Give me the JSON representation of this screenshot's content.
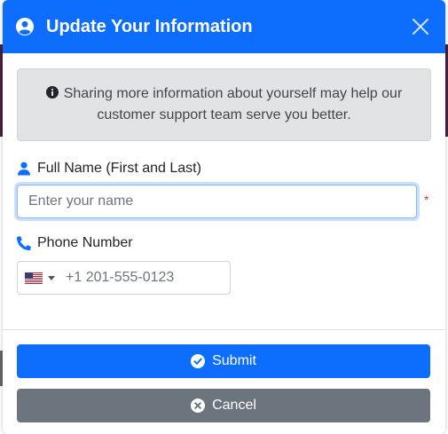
{
  "modal": {
    "title": "Update Your Information",
    "header_icon": "user-circle-icon",
    "close_icon": "close-icon"
  },
  "alert": {
    "icon": "info-circle-icon",
    "text": "Sharing more information about yourself may help our customer support team serve you better."
  },
  "fields": {
    "name": {
      "label": "Full Name (First and Last)",
      "icon": "user-icon",
      "value": "",
      "placeholder": "Enter your name",
      "required_mark": "*"
    },
    "phone": {
      "label": "Phone Number",
      "icon": "phone-icon",
      "country_icon": "us-flag-icon",
      "value": "",
      "placeholder": "+1 201-555-0123"
    }
  },
  "buttons": {
    "submit": {
      "label": "Submit",
      "icon": "check-circle-icon"
    },
    "cancel": {
      "label": "Cancel",
      "icon": "x-circle-icon"
    }
  },
  "colors": {
    "primary": "#0d6efd",
    "secondary": "#6c757d",
    "alert_bg": "#e2e3e5",
    "required": "#dc3545"
  }
}
